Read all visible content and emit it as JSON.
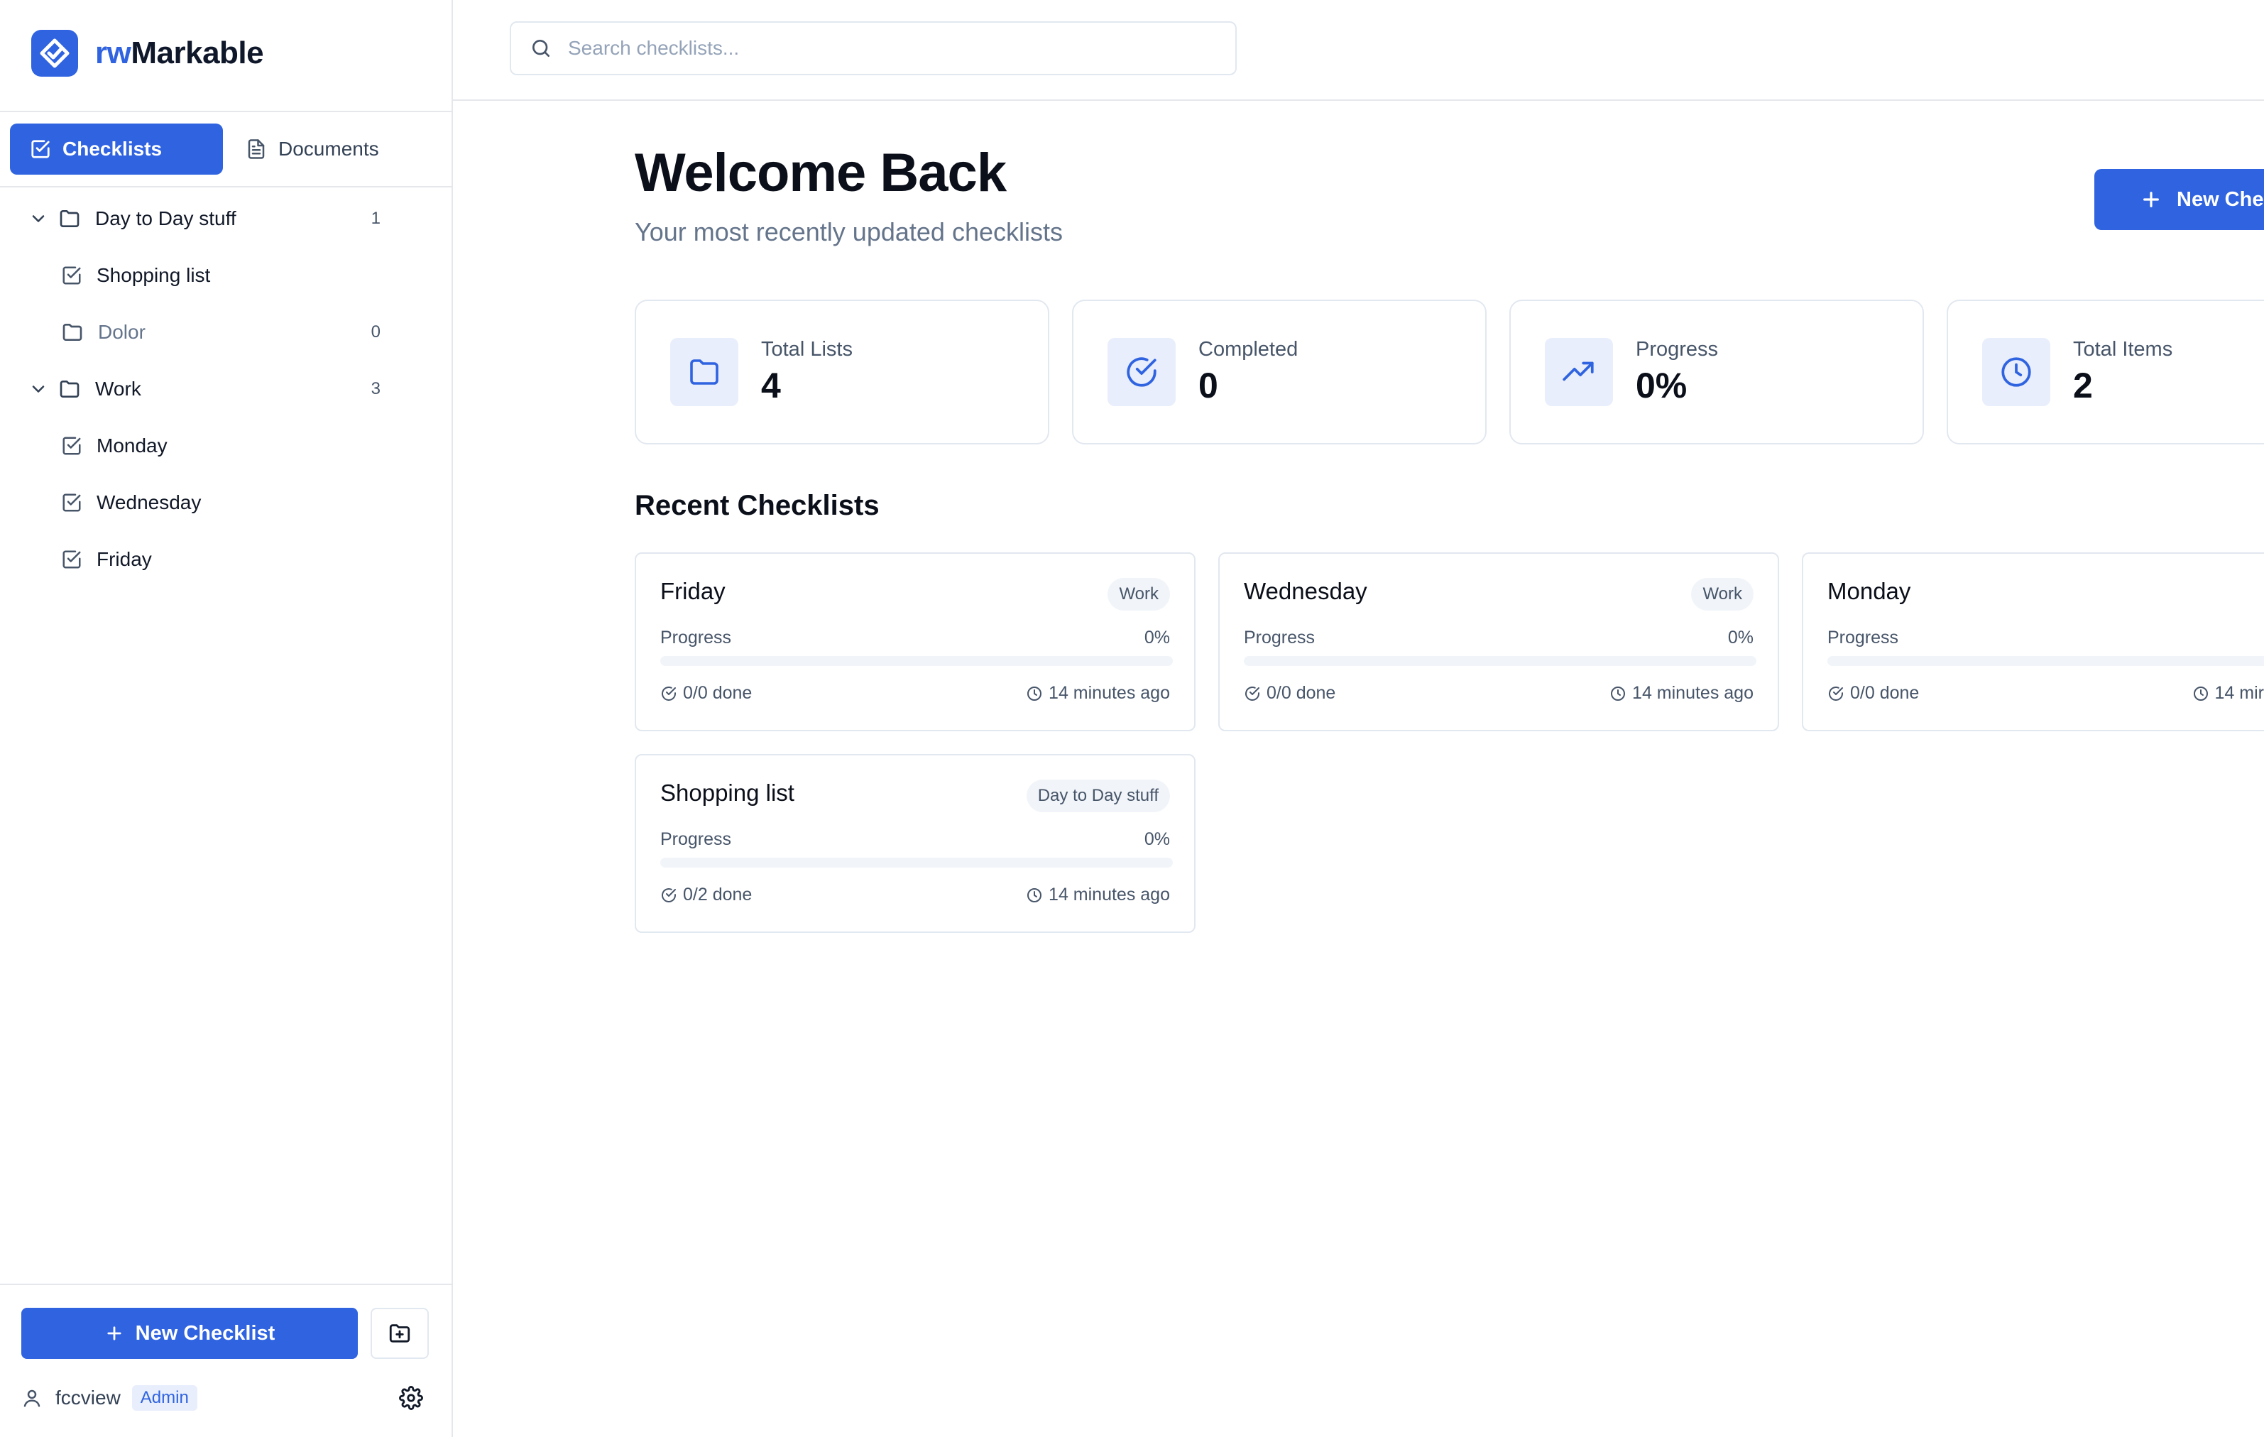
{
  "app": {
    "name_prefix": "rw",
    "name_suffix": "Markable",
    "colors": {
      "accent": "#2f63e0",
      "accent_soft": "#e8eefc",
      "border": "#e2e8f0",
      "muted_text": "#64748b"
    }
  },
  "sidebar": {
    "tabs": [
      {
        "label": "Checklists",
        "icon": "checklist-icon",
        "active": true
      },
      {
        "label": "Documents",
        "icon": "document-icon",
        "active": false
      }
    ],
    "tree": [
      {
        "label": "Day to Day stuff",
        "type": "folder",
        "expanded": true,
        "count": "1",
        "icon": "folder-icon"
      },
      {
        "label": "Shopping list",
        "type": "checklist",
        "icon": "checklist-icon"
      },
      {
        "label": "Dolor",
        "type": "folder",
        "count": "0",
        "icon": "folder-icon"
      },
      {
        "label": "Work",
        "type": "folder",
        "expanded": true,
        "count": "3",
        "icon": "folder-icon"
      },
      {
        "label": "Monday",
        "type": "checklist",
        "icon": "checklist-icon"
      },
      {
        "label": "Wednesday",
        "type": "checklist",
        "icon": "checklist-icon"
      },
      {
        "label": "Friday",
        "type": "checklist",
        "icon": "checklist-icon"
      }
    ],
    "new_button": "New Checklist",
    "user": {
      "name": "fccview",
      "role": "Admin"
    }
  },
  "search": {
    "placeholder": "Search checklists...",
    "value": ""
  },
  "header": {
    "title": "Welcome Back",
    "subtitle": "Your most recently updated checklists",
    "new_button": "New Che"
  },
  "stats": [
    {
      "label": "Total Lists",
      "value": "4",
      "icon": "folder-icon"
    },
    {
      "label": "Completed",
      "value": "0",
      "icon": "check-circle-icon"
    },
    {
      "label": "Progress",
      "value": "0%",
      "icon": "trending-up-icon"
    },
    {
      "label": "Total Items",
      "value": "2",
      "icon": "clock-icon"
    }
  ],
  "recent": {
    "title": "Recent Checklists",
    "cards": [
      {
        "title": "Friday",
        "tag": "Work",
        "progress_label": "Progress",
        "progress_text": "0%",
        "progress": 0,
        "done": "0/0 done",
        "time": "14 minutes ago"
      },
      {
        "title": "Wednesday",
        "tag": "Work",
        "progress_label": "Progress",
        "progress_text": "0%",
        "progress": 0,
        "done": "0/0 done",
        "time": "14 minutes ago"
      },
      {
        "title": "Monday",
        "tag": "",
        "progress_label": "Progress",
        "progress_text": "",
        "progress": 0,
        "done": "0/0 done",
        "time": "14 mir"
      },
      {
        "title": "Shopping list",
        "tag": "Day to Day stuff",
        "progress_label": "Progress",
        "progress_text": "0%",
        "progress": 0,
        "done": "0/2 done",
        "time": "14 minutes ago"
      }
    ]
  }
}
